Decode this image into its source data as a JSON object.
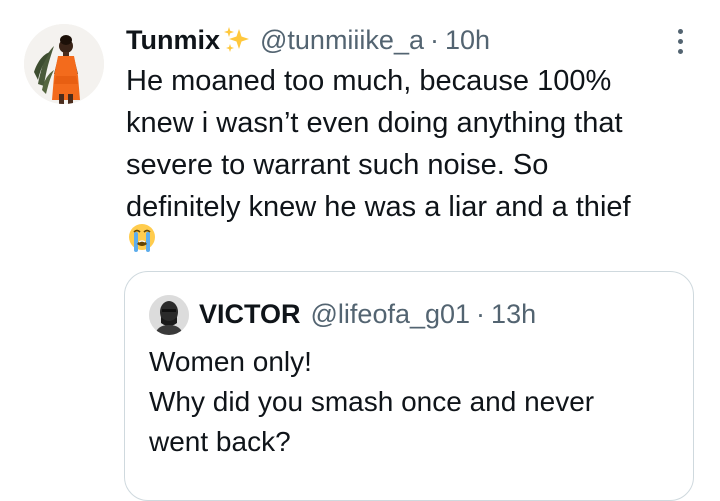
{
  "tweet": {
    "display_name": "Tunmix",
    "name_emoji": "sparkles-emoji",
    "handle": "@tunmiiike_a",
    "separator": "·",
    "time": "10h",
    "more_icon": "more-dots-icon",
    "text_lines": [
      "He moaned too much, because 100%",
      "knew i wasn’t even doing anything that",
      "severe to warrant such noise. So",
      "definitely knew he was a liar and a thief"
    ],
    "trailing_emoji": "crying-face-emoji"
  },
  "quote": {
    "display_name": "VICTOR",
    "handle": "@lifeofa_g01",
    "separator": "·",
    "time": "13h",
    "text_lines": [
      "Women only!",
      "Why did you smash once and never",
      "went back?"
    ]
  },
  "colors": {
    "text": "#0f1419",
    "secondary": "#536471",
    "border": "#cfd9de",
    "avatar_dress": "#f36b1c"
  }
}
